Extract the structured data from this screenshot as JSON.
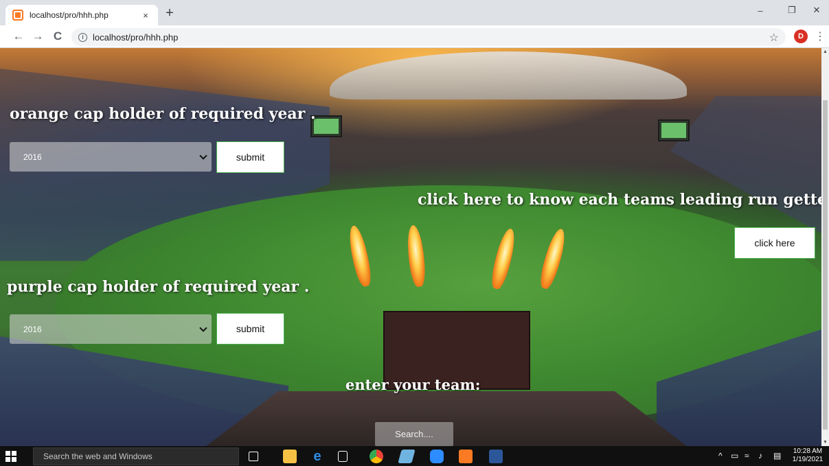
{
  "browser": {
    "tab_title": "localhost/pro/hhh.php",
    "tab_close": "×",
    "new_tab": "+",
    "url": "localhost/pro/hhh.php",
    "avatar_letter": "D",
    "controls": {
      "minimize": "–",
      "restore": "❐",
      "close": "✕"
    },
    "nav": {
      "back": "←",
      "forward": "→",
      "reload": "C"
    },
    "info": "i",
    "star": "☆",
    "menu": "⋮"
  },
  "page": {
    "orange_heading": "orange cap holder of required year .",
    "orange_select_value": "2016",
    "orange_submit": "submit",
    "run_getter_heading": "click here to know each teams leading run getter",
    "click_here": "click here",
    "purple_heading": "purple cap holder of required year .",
    "purple_select_value": "2016",
    "purple_submit": "submit",
    "team_heading": "enter your team:",
    "search_placeholder": "Search...."
  },
  "taskbar": {
    "search_placeholder": "Search the web and Windows",
    "time": "10:28 AM",
    "date": "1/19/2021",
    "tray_up": "^"
  }
}
